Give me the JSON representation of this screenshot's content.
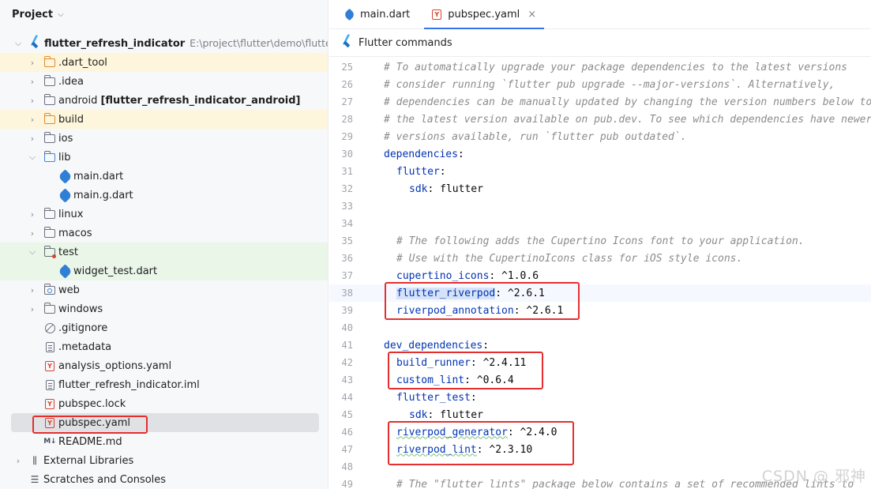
{
  "project_panel": {
    "title": "Project",
    "root": {
      "name": "flutter_refresh_indicator",
      "path": "E:\\project\\flutter\\demo\\flutter_refresh_indicator"
    },
    "items": [
      {
        "label": ".dart_tool",
        "icon": "folder-orange-icon"
      },
      {
        "label": ".idea",
        "icon": "folder-icon"
      },
      {
        "label": "android",
        "suffix": "[flutter_refresh_indicator_android]",
        "icon": "folder-icon"
      },
      {
        "label": "build",
        "icon": "folder-orange-icon"
      },
      {
        "label": "ios",
        "icon": "folder-icon"
      },
      {
        "label": "lib",
        "icon": "folder-icon"
      },
      {
        "label": "main.dart",
        "icon": "dart-icon"
      },
      {
        "label": "main.g.dart",
        "icon": "dart-icon"
      },
      {
        "label": "linux",
        "icon": "folder-icon"
      },
      {
        "label": "macos",
        "icon": "folder-icon"
      },
      {
        "label": "test",
        "icon": "folder-test-icon"
      },
      {
        "label": "widget_test.dart",
        "icon": "dart-icon"
      },
      {
        "label": "web",
        "icon": "folder-web-icon"
      },
      {
        "label": "windows",
        "icon": "folder-icon"
      },
      {
        "label": ".gitignore",
        "icon": "ignore-icon"
      },
      {
        "label": ".metadata",
        "icon": "file-icon"
      },
      {
        "label": "analysis_options.yaml",
        "icon": "yaml-icon"
      },
      {
        "label": "flutter_refresh_indicator.iml",
        "icon": "file-icon"
      },
      {
        "label": "pubspec.lock",
        "icon": "yaml-icon"
      },
      {
        "label": "pubspec.yaml",
        "icon": "yaml-icon"
      },
      {
        "label": "README.md",
        "icon": "markdown-icon"
      },
      {
        "label": "External Libraries",
        "icon": "library-icon"
      },
      {
        "label": "Scratches and Consoles",
        "icon": "console-icon"
      }
    ]
  },
  "editor": {
    "tabs": [
      {
        "label": "main.dart",
        "icon": "dart-icon",
        "active": false
      },
      {
        "label": "pubspec.yaml",
        "icon": "yaml-icon",
        "active": true
      }
    ],
    "yaml_icon_letter": "Y",
    "markdown_icon_text": "M↓",
    "close_glyph": "×",
    "commands_label": "Flutter commands",
    "current_line": 38,
    "lines": [
      {
        "n": "25",
        "text": "# To automatically upgrade your package dependencies to the latest versions"
      },
      {
        "n": "26",
        "text": "# consider running `flutter pub upgrade --major-versions`. Alternatively,"
      },
      {
        "n": "27",
        "text": "# dependencies can be manually updated by changing the version numbers below to"
      },
      {
        "n": "28",
        "text": "# the latest version available on pub.dev. To see which dependencies have newer"
      },
      {
        "n": "29",
        "text": "# versions available, run `flutter pub outdated`."
      },
      {
        "n": "30",
        "key": "dependencies",
        "value": ""
      },
      {
        "n": "31",
        "key": "flutter",
        "value": ""
      },
      {
        "n": "32",
        "key": "sdk",
        "value": " flutter"
      },
      {
        "n": "33",
        "text": ""
      },
      {
        "n": "34",
        "text": ""
      },
      {
        "n": "35",
        "text": "# The following adds the Cupertino Icons font to your application."
      },
      {
        "n": "36",
        "text": "# Use with the CupertinoIcons class for iOS style icons."
      },
      {
        "n": "37",
        "key": "cupertino_icons",
        "value": " ^1.0.6"
      },
      {
        "n": "38",
        "key": "flutter_riverpod",
        "value": " ^2.6.1"
      },
      {
        "n": "39",
        "key": "riverpod_annotation",
        "value": " ^2.6.1"
      },
      {
        "n": "40",
        "text": ""
      },
      {
        "n": "41",
        "key": "dev_dependencies",
        "value": ""
      },
      {
        "n": "42",
        "key": "build_runner",
        "value": " ^2.4.11"
      },
      {
        "n": "43",
        "key": "custom_lint",
        "value": " ^0.6.4"
      },
      {
        "n": "44",
        "key": "flutter_test",
        "value": ""
      },
      {
        "n": "45",
        "key": "sdk",
        "value": " flutter"
      },
      {
        "n": "46",
        "key": "riverpod_generator",
        "value": " ^2.4.0"
      },
      {
        "n": "47",
        "key": "riverpod_lint",
        "value": " ^2.3.10"
      },
      {
        "n": "48",
        "text": ""
      },
      {
        "n": "49",
        "text": "# The \"flutter_lints\" package below contains a set of recommended lints to"
      }
    ]
  },
  "watermark": "CSDN @ 邪神",
  "colors": {
    "highlight_box": "#e52f2f",
    "accent": "#3574f0",
    "comment": "#8c8c8c",
    "key": "#0033b3"
  }
}
